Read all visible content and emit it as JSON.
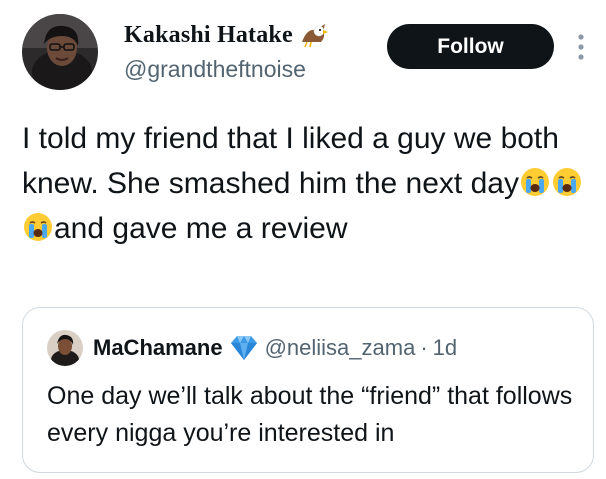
{
  "tweet": {
    "author": {
      "display_name": "Kakashi Hatake",
      "badge_icon": "eagle-emoji",
      "handle": "@grandtheftnoise"
    },
    "follow_label": "Follow",
    "more_icon": "more-vertical-icon",
    "text": {
      "part1": "I told my friend that I liked a guy we both knew. She smashed him the next day",
      "emojis": [
        "crying-face-emoji",
        "crying-face-emoji",
        "crying-face-emoji"
      ],
      "part2": "and gave me a review"
    }
  },
  "quote": {
    "author": {
      "display_name": "MaChamane",
      "badge_icon": "gem-emoji",
      "handle": "@neliisa_zama",
      "separator": "·",
      "time": "1d"
    },
    "text": "One day we’ll talk about the “friend” that follows every nigga you’re interested in"
  },
  "colors": {
    "text_primary": "#0f1419",
    "text_secondary": "#536471",
    "follow_bg": "#0f1419",
    "border": "#cfd9de",
    "gem_blue": "#3b9be8"
  }
}
